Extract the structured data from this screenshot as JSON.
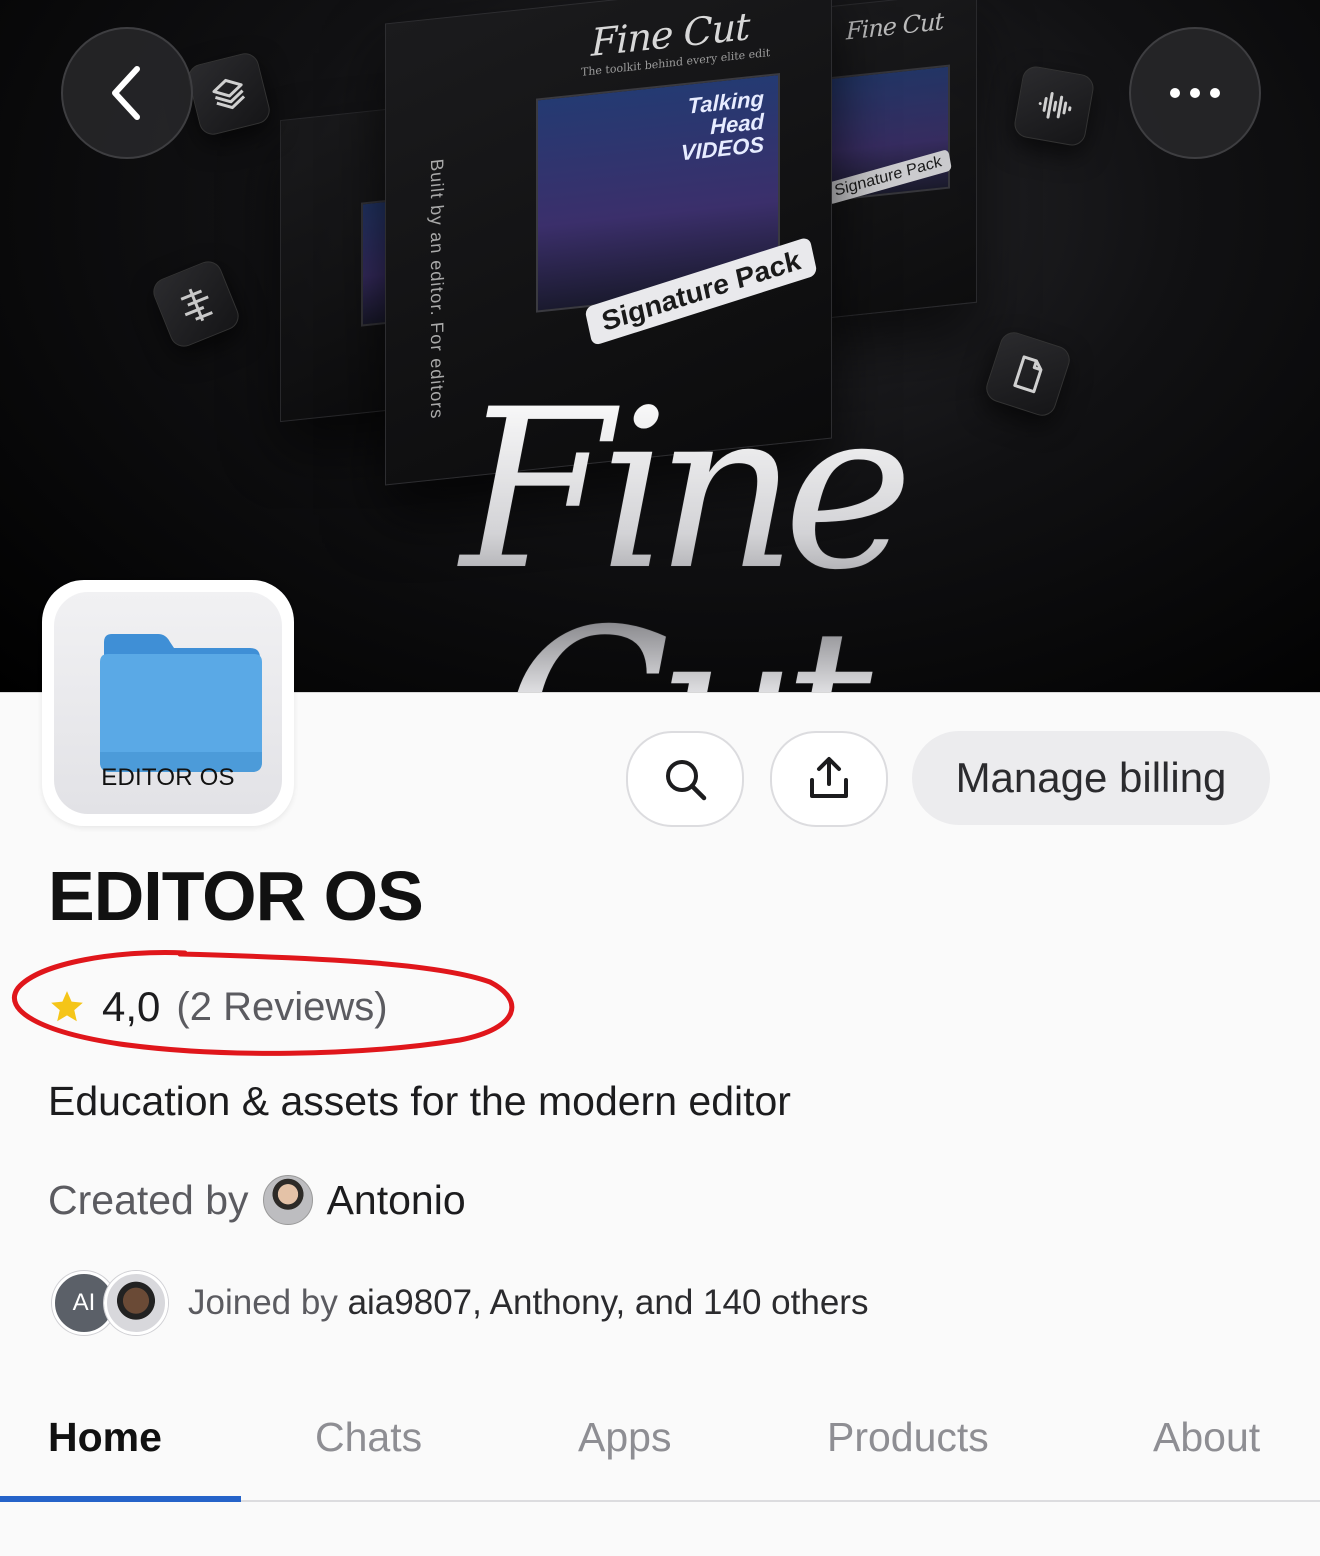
{
  "banner": {
    "hero_title": "Fine Cut",
    "box_title": "Fine Cut",
    "box_subtitle": "The toolkit behind every elite edit",
    "box_vertical_text": "Built by an editor. For editors",
    "box_badge": "Signature Pack",
    "box_screen_label": "Talking Head VIDEOS"
  },
  "header": {
    "back_icon": "chevron-left-icon",
    "more_icon": "ellipsis-icon"
  },
  "app": {
    "icon_name": "folder-icon",
    "icon_label": "EDITOR OS",
    "title": "EDITOR OS",
    "rating": {
      "value": "4,0",
      "count_text": "(2 Reviews)",
      "star_color": "#f5c518"
    },
    "tagline": "Education & assets for the modern editor",
    "created_by_prefix": "Created by",
    "creator_name": "Antonio",
    "joined": {
      "avatar_initials": "AI",
      "prefix": "Joined by",
      "names": "aia9807, Anthony, and 140 others"
    }
  },
  "actions": {
    "search_icon": "search-icon",
    "share_icon": "share-icon",
    "manage_billing_label": "Manage billing"
  },
  "tabs": [
    {
      "label": "Home",
      "active": true
    },
    {
      "label": "Chats",
      "active": false
    },
    {
      "label": "Apps",
      "active": false
    },
    {
      "label": "Products",
      "active": false
    },
    {
      "label": "About",
      "active": false
    }
  ],
  "colors": {
    "accent": "#2563c9",
    "annotation": "#e0161b",
    "folder": "#5aa9e6"
  }
}
